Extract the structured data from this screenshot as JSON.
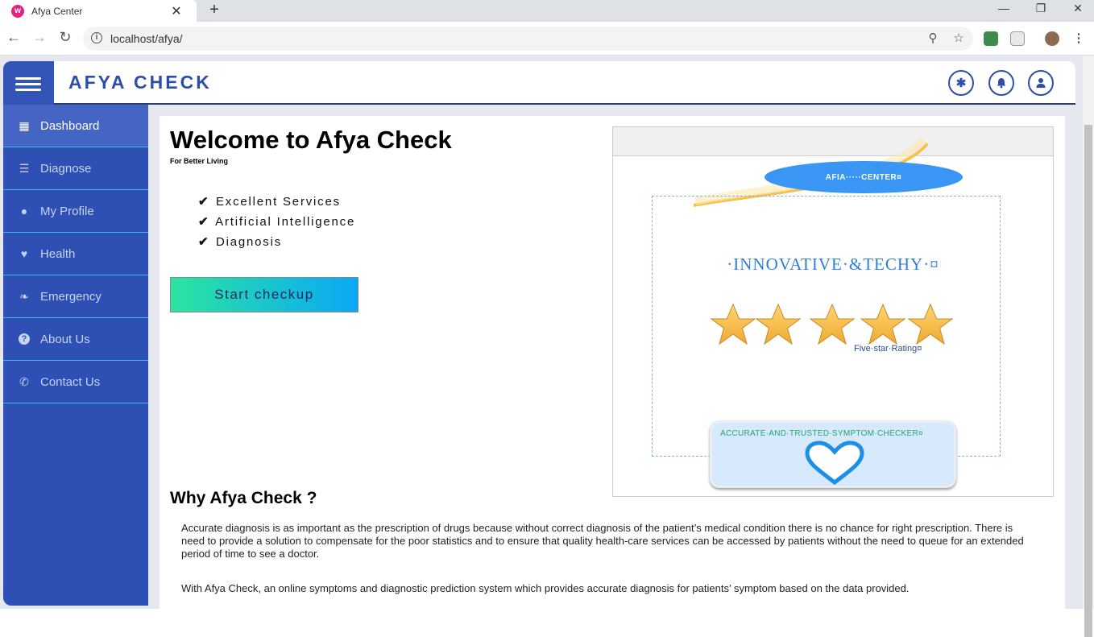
{
  "browser": {
    "tab_title": "Afya Center",
    "tab_favicon": "w",
    "close_glyph": "✕",
    "new_tab_glyph": "+",
    "url": "localhost/afya/"
  },
  "header": {
    "brand": "AFYA CHECK"
  },
  "sidebar": {
    "items": [
      {
        "label": "Dashboard",
        "icon": "dashboard-icon",
        "glyph": "▦",
        "active": true
      },
      {
        "label": "Diagnose",
        "icon": "sliders-icon",
        "glyph": "☰",
        "active": false
      },
      {
        "label": "My Profile",
        "icon": "user-icon",
        "glyph": "●",
        "active": false
      },
      {
        "label": "Health",
        "icon": "heartbeat-icon",
        "glyph": "♥",
        "active": false
      },
      {
        "label": "Emergency",
        "icon": "leaf-icon",
        "glyph": "❧",
        "active": false
      },
      {
        "label": "About Us",
        "icon": "question-circle-icon",
        "glyph": "?",
        "active": false
      },
      {
        "label": "Contact Us",
        "icon": "phone-icon",
        "glyph": "✆",
        "active": false
      }
    ]
  },
  "main": {
    "title": "Welcome to Afya Check",
    "tagline": "For Better Living",
    "features": [
      "Excellent Services",
      "Artificial Intelligence",
      "Diagnosis"
    ],
    "check_glyph": "✔",
    "start_button": "Start checkup",
    "hero": {
      "oval_text": "AFIA·····CENTER¤",
      "headline": "·INNOVATIVE·&TECHY·¤",
      "rating_text": "Five·star·Rating¤",
      "badge_text": "ACCURATE·AND·TRUSTED·SYMPTOM·CHECKER¤"
    },
    "why_title": "Why Afya Check ?",
    "paragraph1": "Accurate diagnosis is as important as the prescription of drugs because without correct diagnosis of the patient’s medical condition there is no chance for right prescription. There is need to provide a solution to compensate for the poor statistics and to ensure that quality health-care services can be accessed by patients without the need to queue for an extended period of time to see a doctor.",
    "paragraph2": "With Afya Check, an online symptoms and diagnostic prediction system which provides accurate diagnosis for patients’ symptom based on the data provided."
  },
  "colors": {
    "sidebar_bg": "#2e4fb3",
    "brand": "#2b4fa8",
    "button_gradient_start": "#2be4a0",
    "button_gradient_end": "#0aa8f5"
  }
}
